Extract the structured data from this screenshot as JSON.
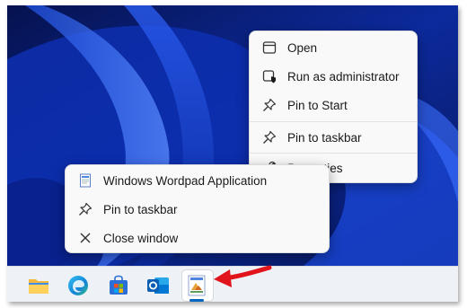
{
  "context_menu_app": {
    "items": [
      {
        "label": "Open",
        "icon": "window-icon"
      },
      {
        "label": "Run as administrator",
        "icon": "shield-icon"
      },
      {
        "label": "Pin to Start",
        "icon": "pin-icon"
      },
      {
        "label": "Pin to taskbar",
        "icon": "pin-icon"
      },
      {
        "label": "Properties",
        "icon": "wrench-icon"
      }
    ]
  },
  "context_menu_taskbar": {
    "items": [
      {
        "label": "Windows Wordpad Application",
        "icon": "wordpad-icon"
      },
      {
        "label": "Pin to taskbar",
        "icon": "pin-icon"
      },
      {
        "label": "Close window",
        "icon": "close-icon"
      }
    ]
  },
  "taskbar": {
    "icons": [
      "file-explorer-icon",
      "edge-icon",
      "microsoft-store-icon",
      "outlook-icon",
      "wordpad-icon"
    ],
    "active_app": "wordpad-icon"
  },
  "colors": {
    "wallpaper": "#0a1a6e",
    "accent": "#0067c0",
    "arrow": "#e0141a"
  }
}
